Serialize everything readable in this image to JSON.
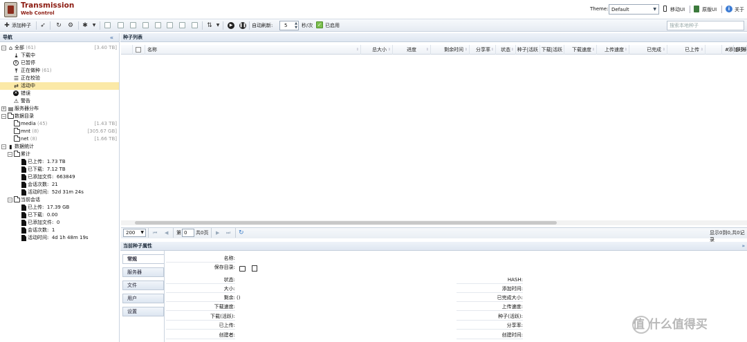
{
  "app": {
    "title": "Transmission",
    "subtitle": "Web Control"
  },
  "header": {
    "theme_label": "Theme:",
    "theme_value": "Default",
    "links": [
      "移动UI",
      "原版UI",
      "关于"
    ]
  },
  "toolbar": {
    "add_torrent": "添加种子",
    "auto_refresh_label": "自动刷新:",
    "auto_refresh_value": "5",
    "refresh_unit": "秒/次",
    "enabled_label": "已启用",
    "search_placeholder": "搜索本地种子"
  },
  "nav": {
    "title": "导航",
    "collapse": "«",
    "all": {
      "label": "全部",
      "count": "(61)",
      "size": "[3.40 TB]"
    },
    "status": [
      {
        "label": "下载中"
      },
      {
        "label": "已暂停"
      },
      {
        "label": "正在做种",
        "count": "(61)"
      },
      {
        "label": "正在校验"
      },
      {
        "label": "活动中"
      },
      {
        "label": "错误"
      },
      {
        "label": "警告"
      }
    ],
    "server_dist": "服务器分布",
    "data_dir": "数据目录",
    "dirs": [
      {
        "label": "media",
        "count": "(45)",
        "size": "[1.43 TB]"
      },
      {
        "label": "mnt",
        "count": "(8)",
        "size": "[305.67 GB]"
      },
      {
        "label": "net",
        "count": "(8)",
        "size": "[1.66 TB]"
      }
    ],
    "stats": "数据统计",
    "total": "累计",
    "total_items": [
      {
        "label": "已上传:",
        "value": "1.73 TB"
      },
      {
        "label": "已下载:",
        "value": "7.12 TB"
      },
      {
        "label": "已添加文件:",
        "value": "663849"
      },
      {
        "label": "会话次数:",
        "value": "21"
      },
      {
        "label": "活动时间:",
        "value": "52d 31m 24s"
      }
    ],
    "session": "当前会话",
    "session_items": [
      {
        "label": "已上传:",
        "value": "17.39 GB"
      },
      {
        "label": "已下载:",
        "value": "0.00"
      },
      {
        "label": "已添加文件:",
        "value": "0"
      },
      {
        "label": "会话次数:",
        "value": "1"
      },
      {
        "label": "活动时间:",
        "value": "4d 1h 48m 19s"
      }
    ]
  },
  "torrents": {
    "title": "种子列表",
    "columns": [
      "名称",
      "总大小",
      "进度",
      "剩余时间",
      "分享率",
      "状态",
      "种子|活跃",
      "下载|活跃",
      "下载速度",
      "上传速度",
      "已完成",
      "已上传",
      "添加时间",
      "#",
      "队列"
    ]
  },
  "pager": {
    "page_size": "200",
    "page_prefix": "第",
    "page_value": "0",
    "page_suffix": "共0页",
    "summary": "显示0到0,共0记录"
  },
  "details": {
    "title": "当前种子属性",
    "tabs": [
      "常规",
      "服务器",
      "文件",
      "用户",
      "设置"
    ],
    "left_fields": [
      {
        "label": "名称:",
        "value": ""
      },
      {
        "label": "保存目录:",
        "value": ""
      },
      {
        "label": "状态:",
        "value": ""
      },
      {
        "label": "大小:",
        "value": ""
      },
      {
        "label": "剩余:",
        "value": "()"
      },
      {
        "label": "下载速度:",
        "value": ""
      },
      {
        "label": "下载(活跃):",
        "value": ""
      },
      {
        "label": "已上传:",
        "value": ""
      },
      {
        "label": "创建者:",
        "value": ""
      }
    ],
    "right_fields": [
      {
        "label": "HASH:"
      },
      {
        "label": "添加时间:"
      },
      {
        "label": "已完成大小:"
      },
      {
        "label": "上传速度:"
      },
      {
        "label": "种子(活跃):"
      },
      {
        "label": "分享率:"
      },
      {
        "label": "创建时间:"
      }
    ]
  },
  "watermark": "值 什么值得买"
}
